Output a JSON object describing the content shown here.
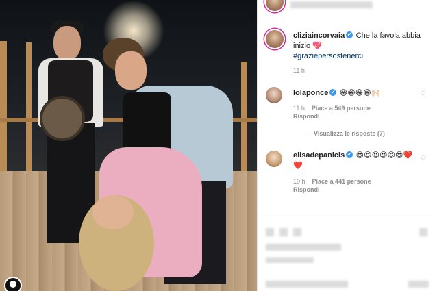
{
  "post": {
    "author": "cliziaincorvaia",
    "caption": "Che la favola abbia inizio 💖",
    "hashtag": "#graziepersostenerci",
    "time": "11 h"
  },
  "comments": [
    {
      "user": "lolaponce",
      "text": "😁😁😁😁🙌🏻",
      "time": "11 h",
      "likes": "Piace a 549 persone",
      "reply": "Rispondi",
      "view_replies": "Visualizza le risposte (7)"
    },
    {
      "user": "elisadepanicis",
      "text": "😍😍😍😍😍😍❤️ ❤️",
      "time": "10 h",
      "likes": "Piace a 441 persone",
      "reply": "Rispondi"
    }
  ],
  "icons": {
    "verified": "✔",
    "heart": "♡"
  },
  "colors": {
    "link": "#003569",
    "verified": "#3897f0",
    "story_ring": "#d6249f"
  }
}
